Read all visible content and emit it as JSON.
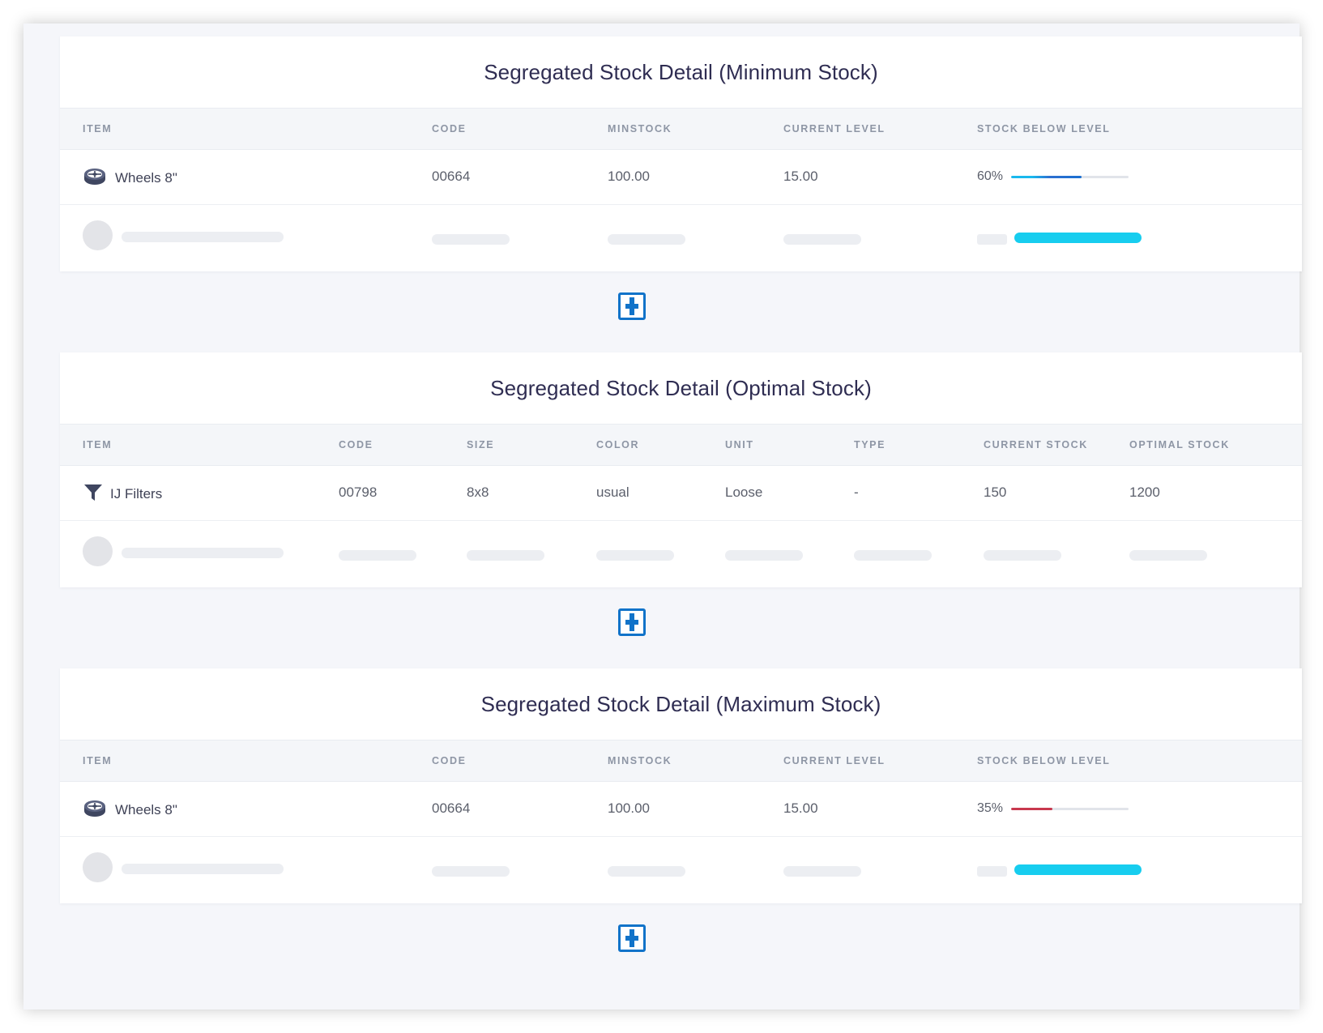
{
  "sections": [
    {
      "title": "Segregated Stock Detail (Minimum Stock)",
      "headers": [
        "ITEM",
        "CODE",
        "MINSTOCK",
        "CURRENT LEVEL",
        "STOCK BELOW LEVEL"
      ],
      "row": {
        "item": "Wheels 8\"",
        "icon": "wheel-icon",
        "code": "00664",
        "minstock": "100.00",
        "current_level": "15.00",
        "stock_below_label": "60%",
        "stock_below_fraction": 0.6,
        "bar_color": "#1a6fd1"
      }
    },
    {
      "title": "Segregated Stock Detail (Optimal Stock)",
      "headers": [
        "ITEM",
        "CODE",
        "SIZE",
        "COLOR",
        "UNIT",
        "TYPE",
        "CURRENT STOCK",
        "OPTIMAL STOCK"
      ],
      "row": {
        "item": "IJ Filters",
        "icon": "filter-icon",
        "code": "00798",
        "size": "8x8",
        "color": "usual",
        "unit": "Loose",
        "type": "-",
        "current_stock": "150",
        "optimal_stock": "1200"
      }
    },
    {
      "title": "Segregated Stock Detail (Maximum Stock)",
      "headers": [
        "ITEM",
        "CODE",
        "MINSTOCK",
        "CURRENT LEVEL",
        "STOCK BELOW LEVEL"
      ],
      "row": {
        "item": "Wheels 8\"",
        "icon": "wheel-icon",
        "code": "00664",
        "minstock": "100.00",
        "current_level": "15.00",
        "stock_below_label": "35%",
        "stock_below_fraction": 0.35,
        "bar_color": "#c8384e"
      }
    }
  ],
  "colors": {
    "accent_blue": "#1173c9",
    "skeleton_accent": "#17cdef",
    "title_text": "#2f2d52"
  }
}
